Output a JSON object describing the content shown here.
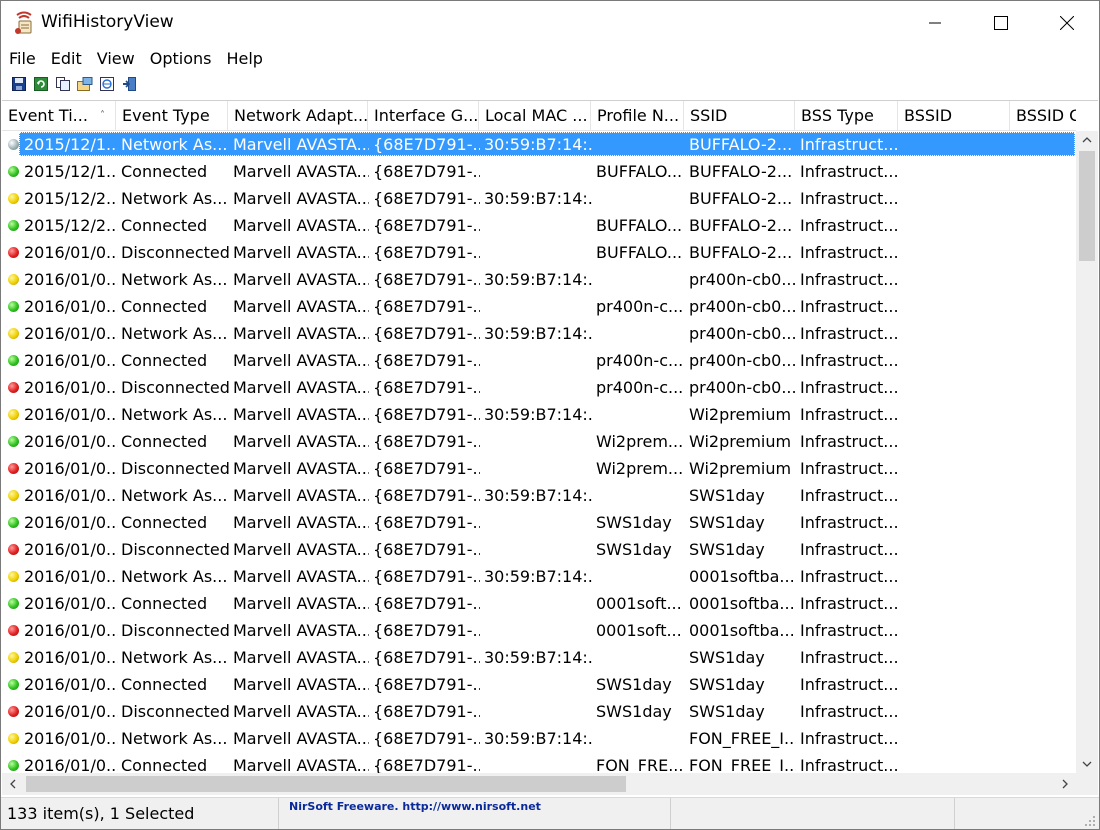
{
  "window": {
    "title": "WifiHistoryView"
  },
  "menu": [
    "File",
    "Edit",
    "View",
    "Options",
    "Help"
  ],
  "toolbar": [
    {
      "name": "save-icon"
    },
    {
      "name": "refresh-icon"
    },
    {
      "name": "copy-icon"
    },
    {
      "name": "properties-icon"
    },
    {
      "name": "html-report-icon"
    },
    {
      "name": "exit-icon"
    }
  ],
  "columns": [
    "Event Ti...",
    "Event Type",
    "Network Adapt...",
    "Interface G...",
    "Local MAC ...",
    "Profile N...",
    "SSID",
    "BSS Type",
    "BSSID",
    "BSSID C"
  ],
  "colors": {
    "selection": "#3399ff",
    "connected": "#2fbf1f",
    "associating": "#f0d000",
    "disconnected": "#e02020",
    "link": "#0a2a9a"
  },
  "rows": [
    {
      "status": "gray",
      "cells": [
        "2015/12/1...",
        "Network As...",
        "Marvell AVASTA...",
        "{68E7D791-...",
        "30:59:B7:14:...",
        "",
        "BUFFALO-2...",
        "Infrastruct...",
        "",
        ""
      ],
      "selected": true
    },
    {
      "status": "green",
      "cells": [
        "2015/12/1...",
        "Connected",
        "Marvell AVASTA...",
        "{68E7D791-...",
        "",
        "BUFFALO...",
        "BUFFALO-2...",
        "Infrastruct...",
        "",
        ""
      ]
    },
    {
      "status": "yellow",
      "cells": [
        "2015/12/2...",
        "Network As...",
        "Marvell AVASTA...",
        "{68E7D791-...",
        "30:59:B7:14:...",
        "",
        "BUFFALO-2...",
        "Infrastruct...",
        "",
        ""
      ]
    },
    {
      "status": "green",
      "cells": [
        "2015/12/2...",
        "Connected",
        "Marvell AVASTA...",
        "{68E7D791-...",
        "",
        "BUFFALO...",
        "BUFFALO-2...",
        "Infrastruct...",
        "",
        ""
      ]
    },
    {
      "status": "red",
      "cells": [
        "2016/01/0...",
        "Disconnected",
        "Marvell AVASTA...",
        "{68E7D791-...",
        "",
        "BUFFALO...",
        "BUFFALO-2...",
        "Infrastruct...",
        "",
        ""
      ]
    },
    {
      "status": "yellow",
      "cells": [
        "2016/01/0...",
        "Network As...",
        "Marvell AVASTA...",
        "{68E7D791-...",
        "30:59:B7:14:...",
        "",
        "pr400n-cb0...",
        "Infrastruct...",
        "",
        ""
      ]
    },
    {
      "status": "green",
      "cells": [
        "2016/01/0...",
        "Connected",
        "Marvell AVASTA...",
        "{68E7D791-...",
        "",
        "pr400n-c...",
        "pr400n-cb0...",
        "Infrastruct...",
        "",
        ""
      ]
    },
    {
      "status": "yellow",
      "cells": [
        "2016/01/0...",
        "Network As...",
        "Marvell AVASTA...",
        "{68E7D791-...",
        "30:59:B7:14:...",
        "",
        "pr400n-cb0...",
        "Infrastruct...",
        "",
        ""
      ]
    },
    {
      "status": "green",
      "cells": [
        "2016/01/0...",
        "Connected",
        "Marvell AVASTA...",
        "{68E7D791-...",
        "",
        "pr400n-c...",
        "pr400n-cb0...",
        "Infrastruct...",
        "",
        ""
      ]
    },
    {
      "status": "red",
      "cells": [
        "2016/01/0...",
        "Disconnected",
        "Marvell AVASTA...",
        "{68E7D791-...",
        "",
        "pr400n-c...",
        "pr400n-cb0...",
        "Infrastruct...",
        "",
        ""
      ]
    },
    {
      "status": "yellow",
      "cells": [
        "2016/01/0...",
        "Network As...",
        "Marvell AVASTA...",
        "{68E7D791-...",
        "30:59:B7:14:...",
        "",
        "Wi2premium",
        "Infrastruct...",
        "",
        ""
      ]
    },
    {
      "status": "green",
      "cells": [
        "2016/01/0...",
        "Connected",
        "Marvell AVASTA...",
        "{68E7D791-...",
        "",
        "Wi2prem...",
        "Wi2premium",
        "Infrastruct...",
        "",
        ""
      ]
    },
    {
      "status": "red",
      "cells": [
        "2016/01/0...",
        "Disconnected",
        "Marvell AVASTA...",
        "{68E7D791-...",
        "",
        "Wi2prem...",
        "Wi2premium",
        "Infrastruct...",
        "",
        ""
      ]
    },
    {
      "status": "yellow",
      "cells": [
        "2016/01/0...",
        "Network As...",
        "Marvell AVASTA...",
        "{68E7D791-...",
        "30:59:B7:14:...",
        "",
        "SWS1day",
        "Infrastruct...",
        "",
        ""
      ]
    },
    {
      "status": "green",
      "cells": [
        "2016/01/0...",
        "Connected",
        "Marvell AVASTA...",
        "{68E7D791-...",
        "",
        "SWS1day",
        "SWS1day",
        "Infrastruct...",
        "",
        ""
      ]
    },
    {
      "status": "red",
      "cells": [
        "2016/01/0...",
        "Disconnected",
        "Marvell AVASTA...",
        "{68E7D791-...",
        "",
        "SWS1day",
        "SWS1day",
        "Infrastruct...",
        "",
        ""
      ]
    },
    {
      "status": "yellow",
      "cells": [
        "2016/01/0...",
        "Network As...",
        "Marvell AVASTA...",
        "{68E7D791-...",
        "30:59:B7:14:...",
        "",
        "0001softba...",
        "Infrastruct...",
        "",
        ""
      ]
    },
    {
      "status": "green",
      "cells": [
        "2016/01/0...",
        "Connected",
        "Marvell AVASTA...",
        "{68E7D791-...",
        "",
        "0001soft...",
        "0001softba...",
        "Infrastruct...",
        "",
        ""
      ]
    },
    {
      "status": "red",
      "cells": [
        "2016/01/0...",
        "Disconnected",
        "Marvell AVASTA...",
        "{68E7D791-...",
        "",
        "0001soft...",
        "0001softba...",
        "Infrastruct...",
        "",
        ""
      ]
    },
    {
      "status": "yellow",
      "cells": [
        "2016/01/0...",
        "Network As...",
        "Marvell AVASTA...",
        "{68E7D791-...",
        "30:59:B7:14:...",
        "",
        "SWS1day",
        "Infrastruct...",
        "",
        ""
      ]
    },
    {
      "status": "green",
      "cells": [
        "2016/01/0...",
        "Connected",
        "Marvell AVASTA...",
        "{68E7D791-...",
        "",
        "SWS1day",
        "SWS1day",
        "Infrastruct...",
        "",
        ""
      ]
    },
    {
      "status": "red",
      "cells": [
        "2016/01/0...",
        "Disconnected",
        "Marvell AVASTA...",
        "{68E7D791-...",
        "",
        "SWS1day",
        "SWS1day",
        "Infrastruct...",
        "",
        ""
      ]
    },
    {
      "status": "yellow",
      "cells": [
        "2016/01/0...",
        "Network As...",
        "Marvell AVASTA...",
        "{68E7D791-...",
        "30:59:B7:14:...",
        "",
        "FON_FREE_I...",
        "Infrastruct...",
        "",
        ""
      ]
    },
    {
      "status": "green",
      "cells": [
        "2016/01/0...",
        "Connected",
        "Marvell AVASTA...",
        "{68E7D791-...",
        "",
        "FON_FRE...",
        "FON_FREE_I...",
        "Infrastruct...",
        "",
        ""
      ]
    }
  ],
  "status": {
    "count": "133 item(s), 1 Selected",
    "link": "NirSoft Freeware.  http://www.nirsoft.net"
  }
}
